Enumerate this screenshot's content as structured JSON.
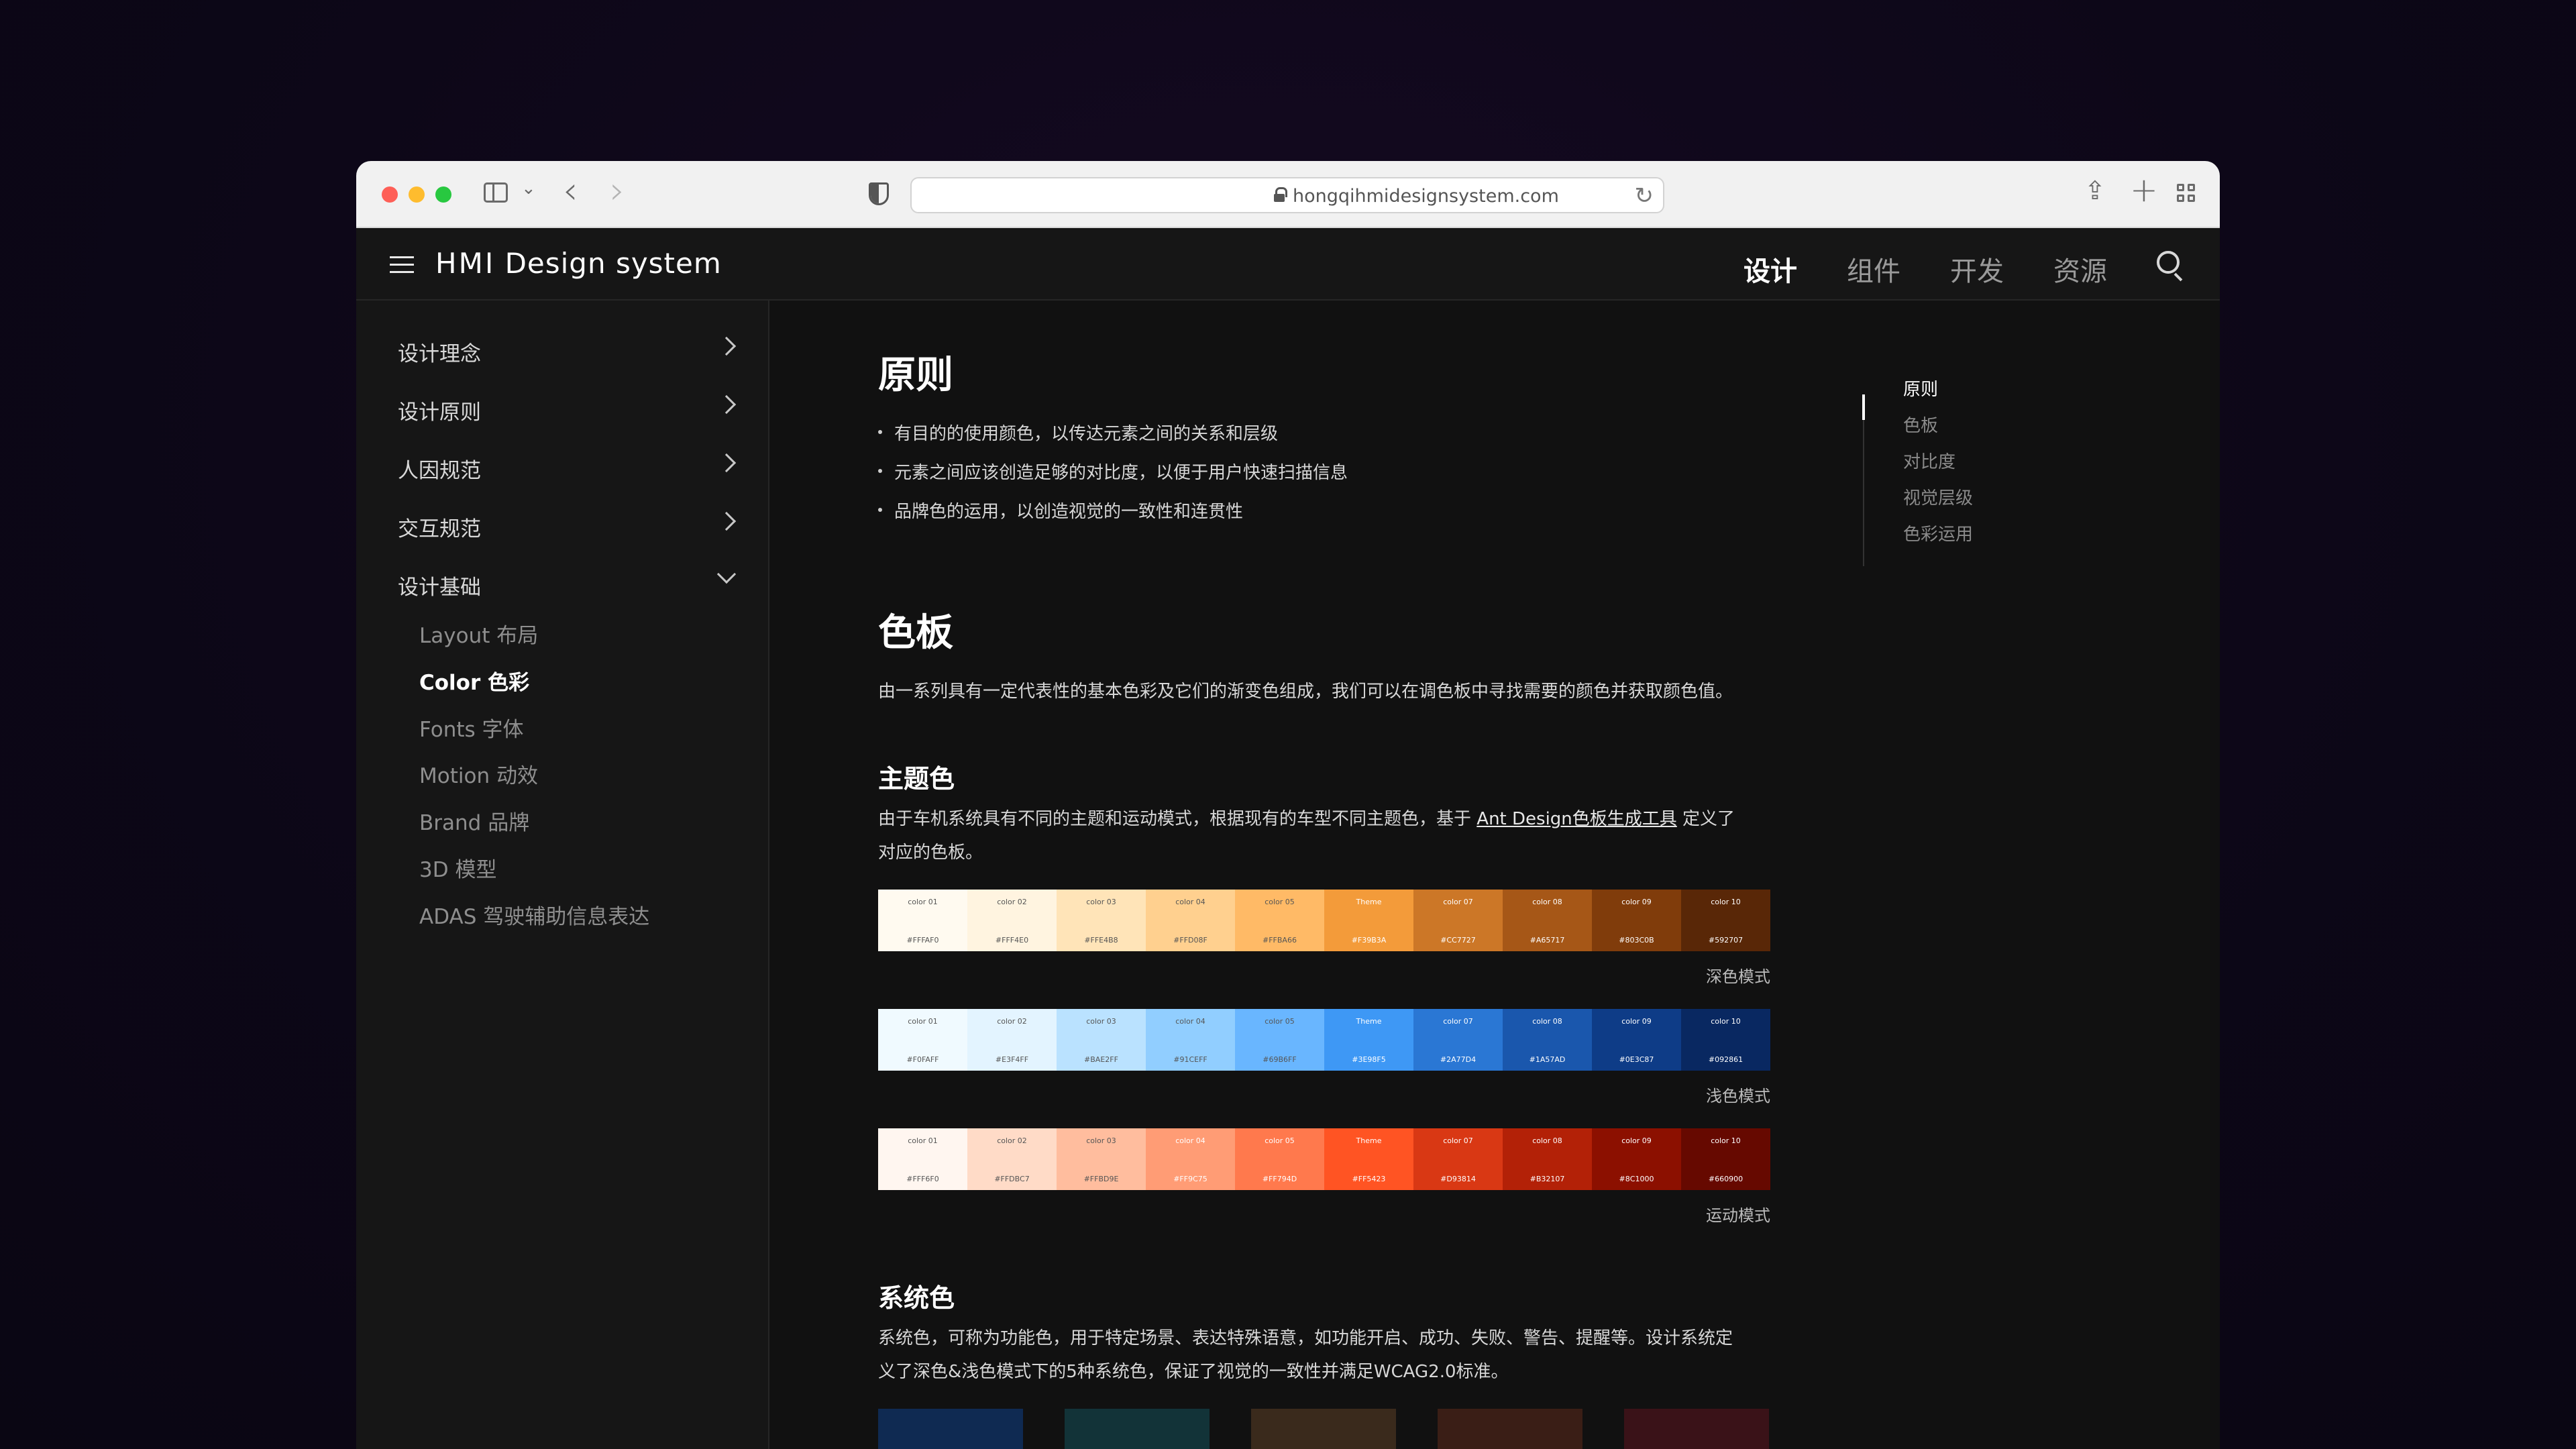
{
  "browser": {
    "url": "hongqihmidesignsystem.com"
  },
  "header": {
    "logo_mark": "HMI",
    "logo_text": "Design system",
    "nav": [
      "设计",
      "组件",
      "开发",
      "资源"
    ],
    "active_nav": "设计"
  },
  "sidebar": {
    "groups": [
      {
        "label": "设计理念",
        "expanded": false
      },
      {
        "label": "设计原则",
        "expanded": false
      },
      {
        "label": "人因规范",
        "expanded": false
      },
      {
        "label": "交互规范",
        "expanded": false
      },
      {
        "label": "设计基础",
        "expanded": true
      }
    ],
    "subitems": [
      "Layout 布局",
      "Color 色彩",
      "Fonts 字体",
      "Motion 动效",
      "Brand 品牌",
      "3D 模型",
      "ADAS 驾驶辅助信息表达"
    ],
    "active_subitem": "Color 色彩"
  },
  "content": {
    "principles_title": "原则",
    "principles": [
      "有目的的使用颜色，以传达元素之间的关系和层级",
      "元素之间应该创造足够的对比度，以便于用户快速扫描信息",
      "品牌色的运用，以创造视觉的一致性和连贯性"
    ],
    "palette_title": "色板",
    "palette_desc": "由一系列具有一定代表性的基本色彩及它们的渐变色组成，我们可以在调色板中寻找需要的颜色并获取颜色值。",
    "theme_title": "主题色",
    "theme_desc_before": "由于车机系统具有不同的主题和运动模式，根据现有的车型不同主题色，基于 ",
    "theme_desc_link": "Ant Design色板生成工具",
    "theme_desc_after": " 定义了",
    "theme_desc_line2": "对应的色板。",
    "system_title": "系统色",
    "system_desc_line1": "系统色，可称为功能色，用于特定场景、表达特殊语意，如功能开启、成功、失败、警告、提醒等。设计系统定",
    "system_desc_line2": "义了深色&浅色模式下的5种系统色，保证了视觉的一致性并满足WCAG2.0标准。"
  },
  "palettes": [
    {
      "mode_label": "深色模式",
      "swatches": [
        {
          "name": "color 01",
          "hex": "#FFFAF0",
          "color": "#fffaf0",
          "text": "#555"
        },
        {
          "name": "color 02",
          "hex": "#FFF4E0",
          "color": "#fff4e0",
          "text": "#555"
        },
        {
          "name": "color 03",
          "hex": "#FFE4B8",
          "color": "#ffe4b8",
          "text": "#555"
        },
        {
          "name": "color 04",
          "hex": "#FFD08F",
          "color": "#ffd08f",
          "text": "#555"
        },
        {
          "name": "color 05",
          "hex": "#FFBA66",
          "color": "#ffba66",
          "text": "#555"
        },
        {
          "name": "Theme",
          "hex": "#F39B3A",
          "color": "#f39b3a",
          "text": "#fff"
        },
        {
          "name": "color 07",
          "hex": "#CC7727",
          "color": "#cc7727",
          "text": "#fff"
        },
        {
          "name": "color 08",
          "hex": "#A65717",
          "color": "#a65717",
          "text": "#fff"
        },
        {
          "name": "color 09",
          "hex": "#803C0B",
          "color": "#803c0b",
          "text": "#fff"
        },
        {
          "name": "color 10",
          "hex": "#592707",
          "color": "#592707",
          "text": "#fff"
        }
      ]
    },
    {
      "mode_label": "浅色模式",
      "swatches": [
        {
          "name": "color 01",
          "hex": "#F0FAFF",
          "color": "#f0faff",
          "text": "#555"
        },
        {
          "name": "color 02",
          "hex": "#E3F4FF",
          "color": "#e3f4ff",
          "text": "#555"
        },
        {
          "name": "color 03",
          "hex": "#BAE2FF",
          "color": "#bae2ff",
          "text": "#555"
        },
        {
          "name": "color 04",
          "hex": "#91CEFF",
          "color": "#91ceff",
          "text": "#555"
        },
        {
          "name": "color 05",
          "hex": "#69B6FF",
          "color": "#69b6ff",
          "text": "#555"
        },
        {
          "name": "Theme",
          "hex": "#3E98F5",
          "color": "#3e98f5",
          "text": "#fff"
        },
        {
          "name": "color 07",
          "hex": "#2A77D4",
          "color": "#2a77d4",
          "text": "#fff"
        },
        {
          "name": "color 08",
          "hex": "#1A57AD",
          "color": "#1a57ad",
          "text": "#fff"
        },
        {
          "name": "color 09",
          "hex": "#0E3C87",
          "color": "#0e3c87",
          "text": "#fff"
        },
        {
          "name": "color 10",
          "hex": "#092861",
          "color": "#092861",
          "text": "#fff"
        }
      ]
    },
    {
      "mode_label": "运动模式",
      "swatches": [
        {
          "name": "color 01",
          "hex": "#FFF6F0",
          "color": "#fff6f0",
          "text": "#555"
        },
        {
          "name": "color 02",
          "hex": "#FFDBC7",
          "color": "#ffdbc7",
          "text": "#555"
        },
        {
          "name": "color 03",
          "hex": "#FFBD9E",
          "color": "#ffbd9e",
          "text": "#555"
        },
        {
          "name": "color 04",
          "hex": "#FF9C75",
          "color": "#ff9c75",
          "text": "#fff"
        },
        {
          "name": "color 05",
          "hex": "#FF794D",
          "color": "#ff794d",
          "text": "#fff"
        },
        {
          "name": "Theme",
          "hex": "#FF5423",
          "color": "#ff5423",
          "text": "#fff"
        },
        {
          "name": "color 07",
          "hex": "#D93814",
          "color": "#d93814",
          "text": "#fff"
        },
        {
          "name": "color 08",
          "hex": "#B32107",
          "color": "#b32107",
          "text": "#fff"
        },
        {
          "name": "color 09",
          "hex": "#8C1000",
          "color": "#8c1000",
          "text": "#fff"
        },
        {
          "name": "color 10",
          "hex": "#660900",
          "color": "#660900",
          "text": "#fff"
        }
      ]
    }
  ],
  "system_swatches": [
    "#0f2a52",
    "#123338",
    "#3a2a1c",
    "#3a1e16",
    "#3a1218"
  ],
  "toc": {
    "items": [
      "原则",
      "色板",
      "对比度",
      "视觉层级",
      "色彩运用"
    ],
    "active": "原则"
  }
}
